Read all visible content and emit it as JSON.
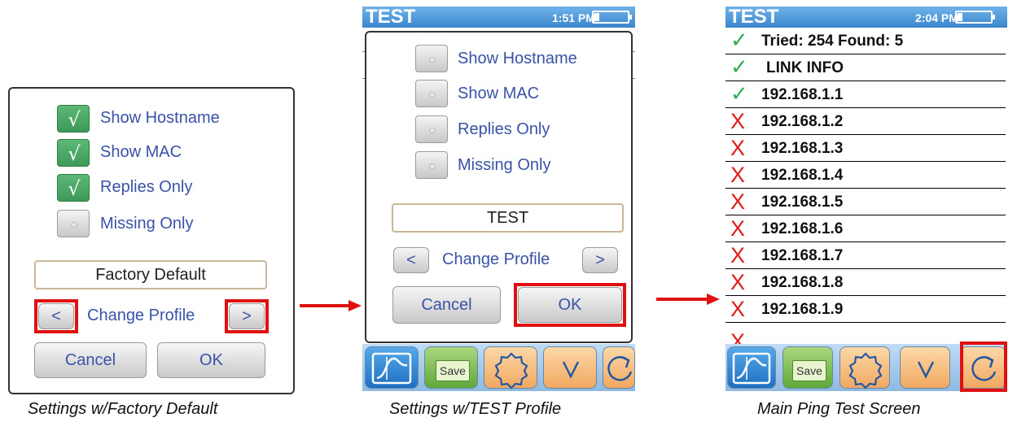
{
  "panel1": {
    "caption": "Settings w/Factory Default",
    "options": [
      {
        "label": "Show Hostname",
        "checked": true
      },
      {
        "label": "Show MAC",
        "checked": true
      },
      {
        "label": "Replies Only",
        "checked": true
      },
      {
        "label": "Missing Only",
        "checked": false
      }
    ],
    "profile_name": "Factory Default",
    "prev_label": "<",
    "change_profile_label": "Change Profile",
    "next_label": ">",
    "cancel_label": "Cancel",
    "ok_label": "OK"
  },
  "panel2": {
    "caption": "Settings w/TEST Profile",
    "title": "TEST",
    "time": "1:51 PM",
    "options": [
      {
        "label": "Show Hostname",
        "checked": false
      },
      {
        "label": "Show MAC",
        "checked": false
      },
      {
        "label": "Replies Only",
        "checked": false
      },
      {
        "label": "Missing Only",
        "checked": false
      }
    ],
    "profile_name": "TEST",
    "prev_label": "<",
    "change_profile_label": "Change Profile",
    "next_label": ">",
    "cancel_label": "Cancel",
    "ok_label": "OK",
    "toolbar": {
      "save_label": "Save"
    }
  },
  "panel3": {
    "caption": "Main Ping Test Screen",
    "title": "TEST",
    "time": "2:04 PM",
    "summary": "Tried: 254 Found: 5",
    "link_info": "LINK INFO",
    "rows": [
      {
        "ip": "192.168.1.1",
        "status": "ok"
      },
      {
        "ip": "192.168.1.2",
        "status": "fail"
      },
      {
        "ip": "192.168.1.3",
        "status": "fail"
      },
      {
        "ip": "192.168.1.4",
        "status": "fail"
      },
      {
        "ip": "192.168.1.5",
        "status": "fail"
      },
      {
        "ip": "192.168.1.6",
        "status": "fail"
      },
      {
        "ip": "192.168.1.7",
        "status": "fail"
      },
      {
        "ip": "192.168.1.8",
        "status": "fail"
      },
      {
        "ip": "192.168.1.9",
        "status": "fail"
      }
    ],
    "toolbar": {
      "save_label": "Save"
    }
  },
  "marks": {
    "check": "✓",
    "cross": "X"
  },
  "colors": {
    "highlight": "#e01010",
    "label_blue": "#3a52a8",
    "check_green": "#2fae52",
    "fail_red": "#e21a1a",
    "titlebar_blue": "#3a86cc"
  }
}
